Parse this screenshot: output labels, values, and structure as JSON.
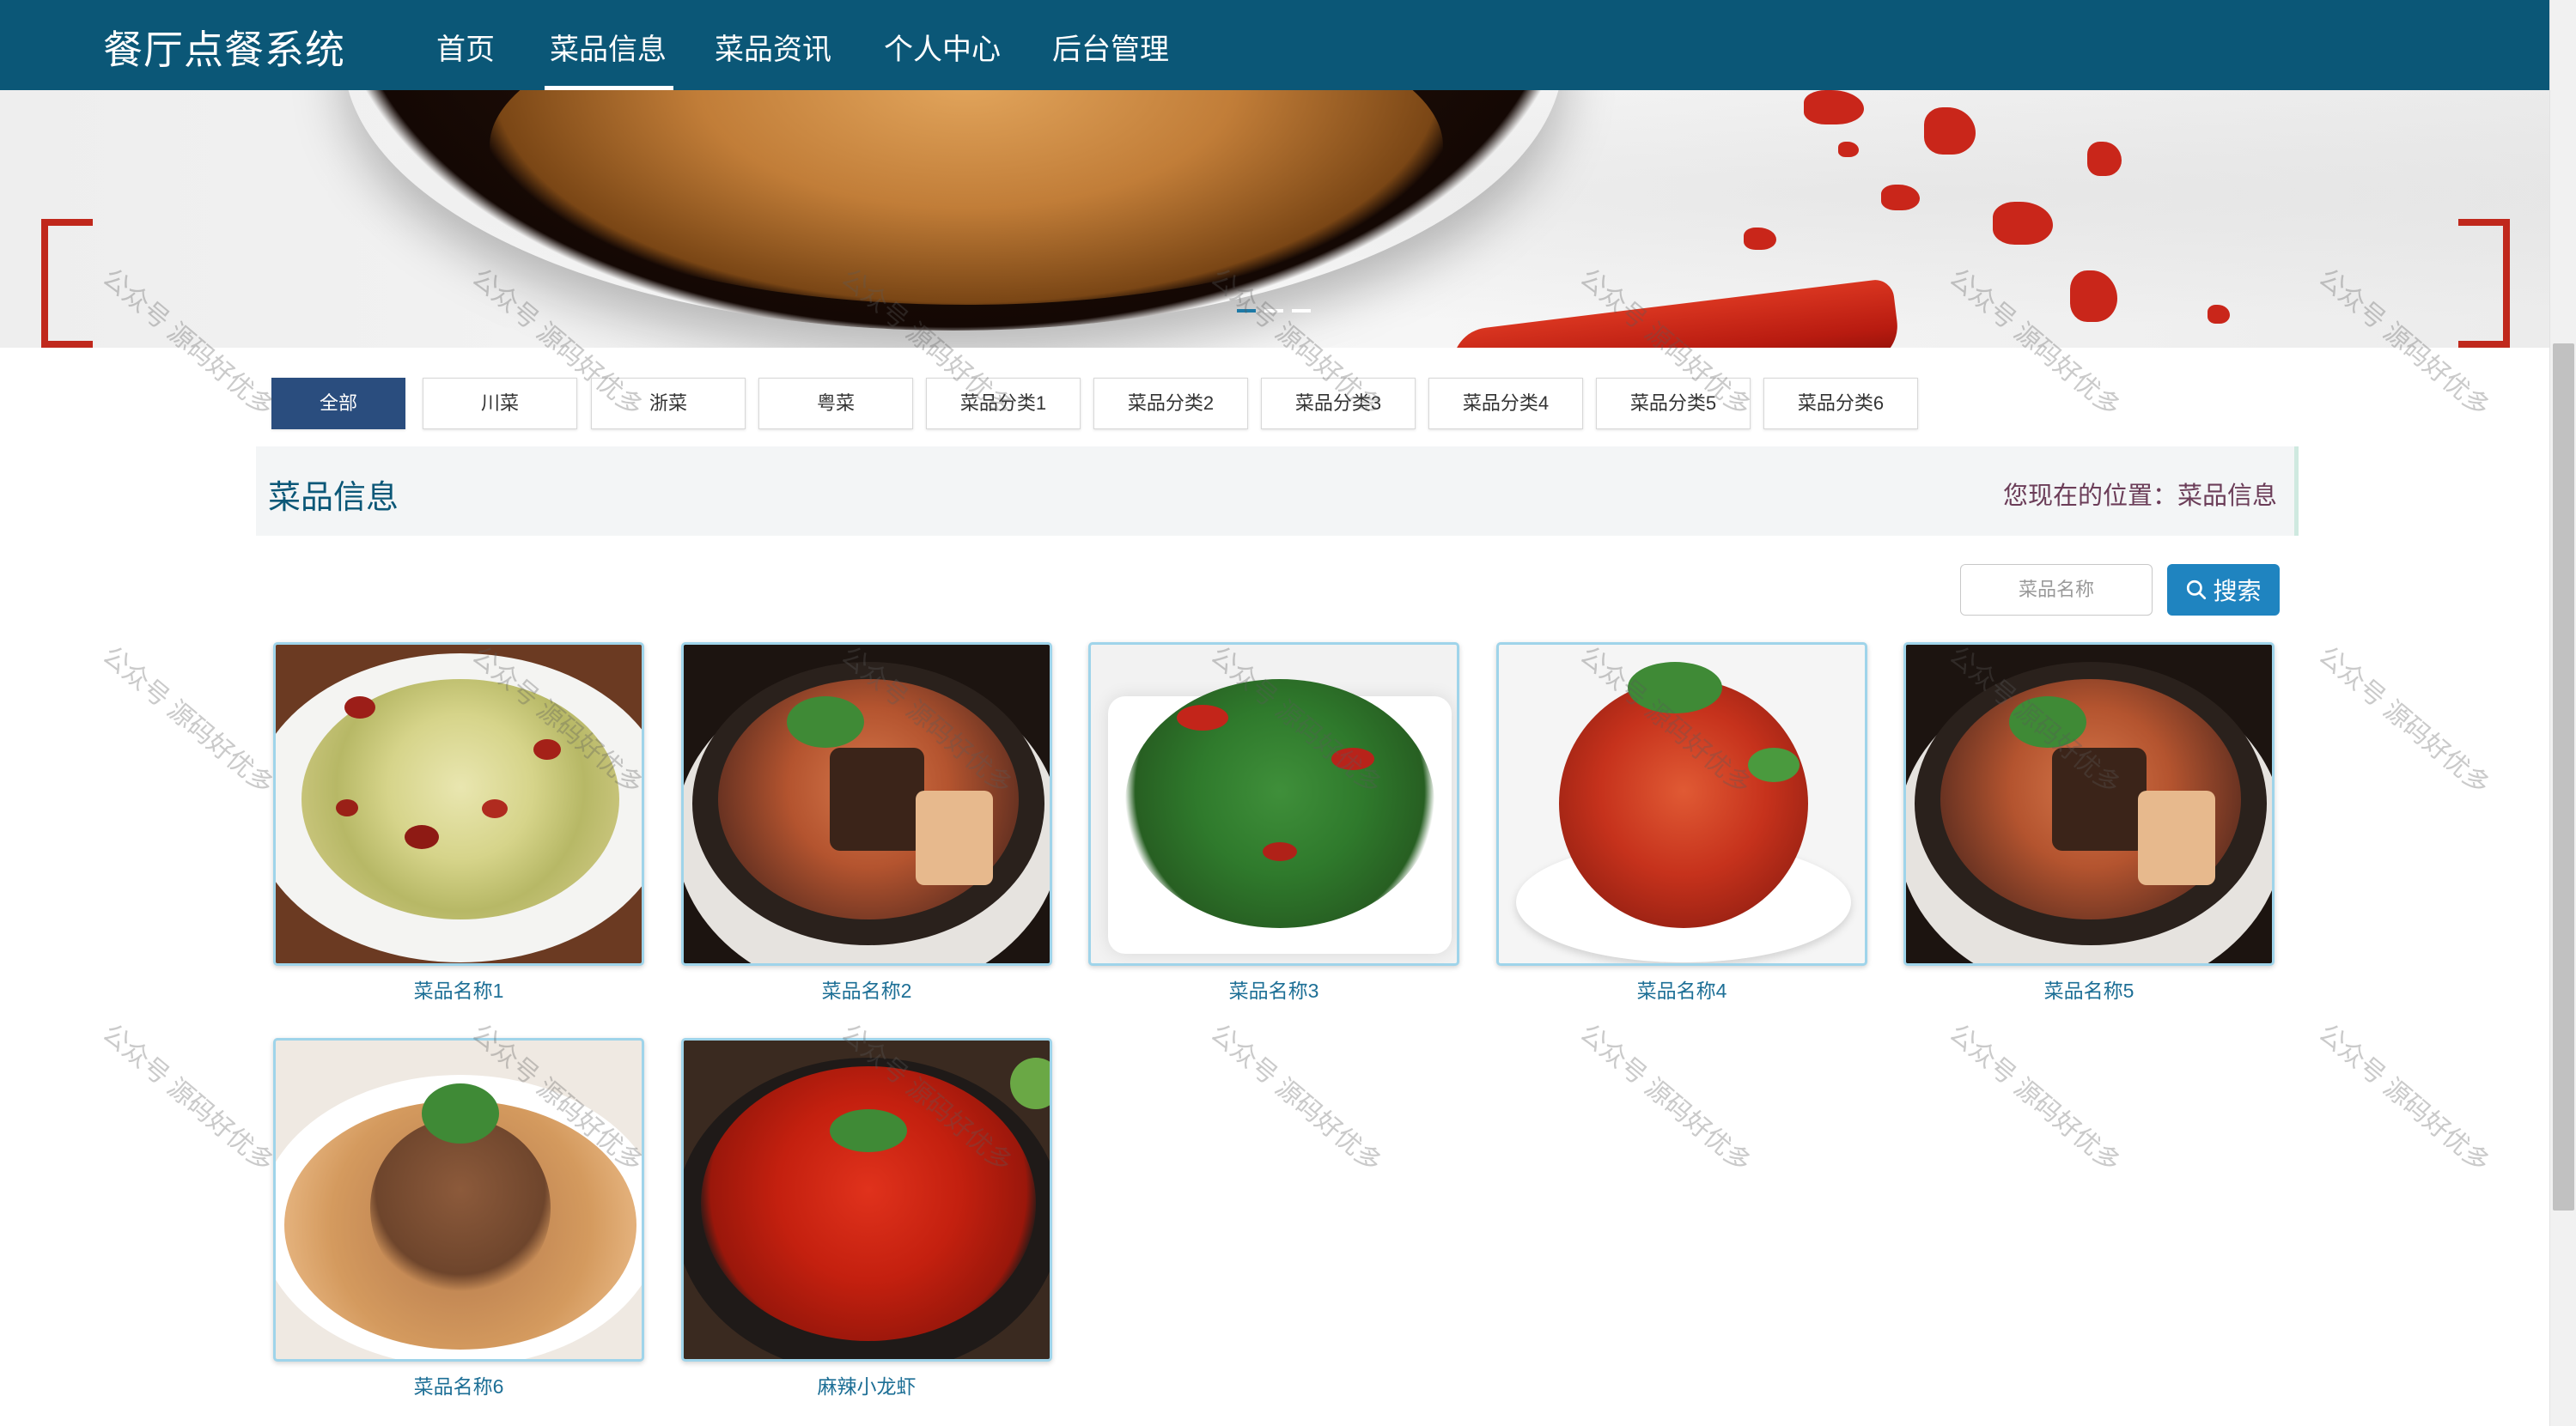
{
  "header": {
    "brand": "餐厅点餐系统",
    "nav": [
      {
        "label": "首页",
        "active": false
      },
      {
        "label": "菜品信息",
        "active": true
      },
      {
        "label": "菜品资讯",
        "active": false
      },
      {
        "label": "个人中心",
        "active": false
      },
      {
        "label": "后台管理",
        "active": false
      }
    ]
  },
  "banner": {
    "slides": 3,
    "active_slide": 1
  },
  "categories": [
    {
      "label": "全部",
      "active": true
    },
    {
      "label": "川菜",
      "active": false
    },
    {
      "label": "浙菜",
      "active": false
    },
    {
      "label": "粤菜",
      "active": false
    },
    {
      "label": "菜品分类1",
      "active": false
    },
    {
      "label": "菜品分类2",
      "active": false
    },
    {
      "label": "菜品分类3",
      "active": false
    },
    {
      "label": "菜品分类4",
      "active": false
    },
    {
      "label": "菜品分类5",
      "active": false
    },
    {
      "label": "菜品分类6",
      "active": false
    }
  ],
  "section": {
    "title": "菜品信息",
    "breadcrumb_prefix": "您现在的位置：",
    "breadcrumb_current": "菜品信息"
  },
  "search": {
    "placeholder": "菜品名称",
    "button_label": "搜索"
  },
  "products": [
    {
      "name": "菜品名称1",
      "image": "stir-fried-cabbage-photo"
    },
    {
      "name": "菜品名称2",
      "image": "braised-pork-claypot-photo"
    },
    {
      "name": "菜品名称3",
      "image": "dry-fried-green-beans-photo"
    },
    {
      "name": "菜品名称4",
      "image": "spicy-shredded-dish-photo"
    },
    {
      "name": "菜品名称5",
      "image": "braised-pork-claypot-photo"
    },
    {
      "name": "菜品名称6",
      "image": "sesame-beef-slices-photo"
    },
    {
      "name": "麻辣小龙虾",
      "image": "spicy-crayfish-photo"
    }
  ],
  "watermark": {
    "text": "公众号 源码好优多"
  },
  "colors": {
    "nav_bg": "#0b5777",
    "accent": "#1f84c0",
    "category_active": "#2a4d7e",
    "product_name": "#1d6f96"
  }
}
